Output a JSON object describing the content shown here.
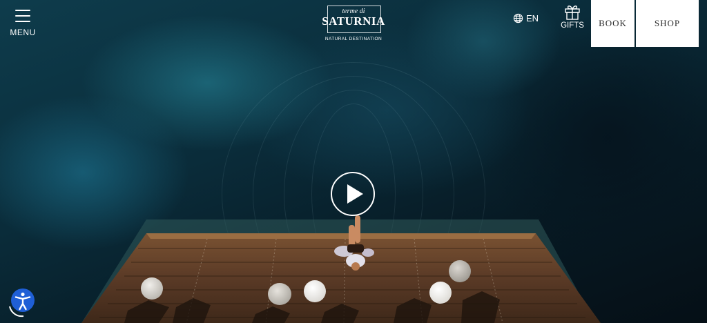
{
  "header": {
    "menu_label": "MENU",
    "logo": {
      "small_text": "terme di",
      "main_text": "SATURNIA",
      "tagline": "NATURAL DESTINATION"
    },
    "language": "EN",
    "gifts_label": "GIFTS",
    "book_label": "BOOK",
    "shop_label": "SHOP"
  },
  "hero": {
    "video_control": "play-icon"
  },
  "accessibility": {
    "icon": "accessibility-icon"
  },
  "colors": {
    "water": "#0a2c3a",
    "deck_wood": "#5a3a26",
    "button_bg": "#ffffff",
    "accessibility_blue": "#1f5fd6"
  }
}
